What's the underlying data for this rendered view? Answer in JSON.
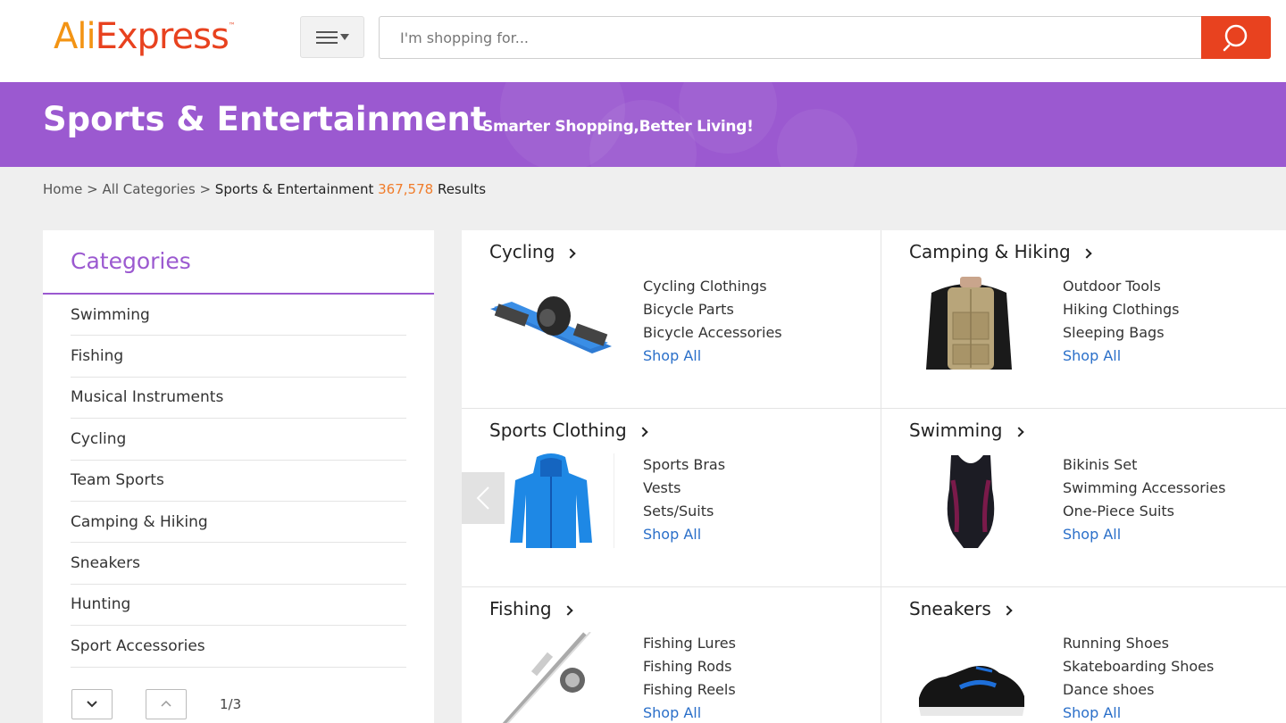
{
  "header": {
    "logo_part1": "Ali",
    "logo_part2": "Express",
    "logo_tm": "™",
    "search_placeholder": "I'm shopping for..."
  },
  "banner": {
    "title": "Sports & Entertainment",
    "subtitle": "Smarter Shopping,Better Living!"
  },
  "breadcrumb": {
    "home": "Home",
    "sep": ">",
    "all": "All Categories",
    "current": "Sports & Entertainment",
    "count": "367,578",
    "results": "Results"
  },
  "sidebar": {
    "title": "Categories",
    "items": [
      "Swimming",
      "Fishing",
      "Musical Instruments",
      "Cycling",
      "Team Sports",
      "Camping & Hiking",
      "Sneakers",
      "Hunting",
      "Sport Accessories"
    ],
    "page": "1/3"
  },
  "cells": [
    {
      "title": "Cycling",
      "links": [
        "Cycling Clothings",
        "Bicycle Parts",
        "Bicycle Accessories"
      ],
      "shop_all": "Shop All"
    },
    {
      "title": "Camping & Hiking",
      "links": [
        "Outdoor Tools",
        "Hiking Clothings",
        "Sleeping Bags"
      ],
      "shop_all": "Shop All"
    },
    {
      "title": "Sports Clothing",
      "links": [
        "Sports Bras",
        "Vests",
        "Sets/Suits"
      ],
      "shop_all": "Shop All"
    },
    {
      "title": "Swimming",
      "links": [
        "Bikinis Set",
        "Swimming Accessories",
        "One-Piece Suits"
      ],
      "shop_all": "Shop All"
    },
    {
      "title": "Fishing",
      "links": [
        "Fishing Lures",
        "Fishing Rods",
        "Fishing Reels"
      ],
      "shop_all": "Shop All"
    },
    {
      "title": "Sneakers",
      "links": [
        "Running Shoes",
        "Skateboarding Shoes",
        "Dance shoes"
      ],
      "shop_all": "Shop All"
    }
  ],
  "colors": {
    "brand_orange": "#f39414",
    "brand_red": "#e8421f",
    "banner_purple": "#9b59d0",
    "link_blue": "#2a6fc9",
    "count_orange": "#f07c2a"
  },
  "icons": [
    "menu-icon",
    "search-icon",
    "chevron-down-icon",
    "chevron-up-icon",
    "chevron-right-icon",
    "chevron-left-icon"
  ]
}
